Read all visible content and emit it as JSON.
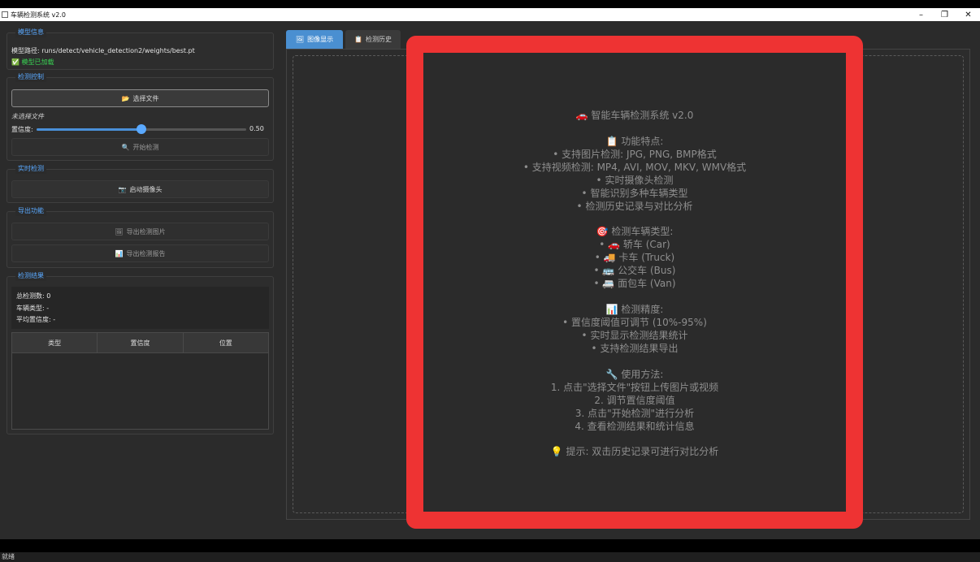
{
  "window": {
    "title": "车辆检测系统 v2.0",
    "controls": {
      "minimize": "–",
      "restore": "❐",
      "close": "✕"
    }
  },
  "model_info": {
    "title": "模型信息",
    "path_label": "模型路径: runs/detect/vehicle_detection2/weights/best.pt",
    "loaded_status": "✅ 模型已加载",
    "status_color": "#39d353"
  },
  "detect_control": {
    "title": "检测控制",
    "select_file_button": "选择文件",
    "select_file_icon": "📂",
    "no_file_label": "未选择文件",
    "confidence_label": "置信度:",
    "confidence_value": "0.50",
    "confidence_fraction": 0.5,
    "start_button": "开始检测",
    "start_icon": "🔍"
  },
  "realtime": {
    "title": "实时检测",
    "camera_button": "启动摄像头",
    "camera_icon": "📷"
  },
  "export": {
    "title": "导出功能",
    "export_image_button": "导出检测图片",
    "export_image_icon": "🖼",
    "export_report_button": "导出检测报告",
    "export_report_icon": "📊"
  },
  "results": {
    "title": "检测结果",
    "total": "总检测数: 0",
    "vehicle_type": "车辆类型: -",
    "avg_conf": "平均置信度: -",
    "columns": [
      "类型",
      "置信度",
      "位置"
    ]
  },
  "tabs": [
    {
      "label": "图像显示",
      "icon": "🖼",
      "active": true
    },
    {
      "label": "检测历史",
      "icon": "📋",
      "active": false
    }
  ],
  "info_lines": [
    "🚗 智能车辆检测系统 v2.0",
    "",
    "📋 功能特点:",
    "• 支持图片检测: JPG, PNG, BMP格式",
    "• 支持视频检测: MP4, AVI, MOV, MKV, WMV格式",
    "• 实时摄像头检测",
    "• 智能识别多种车辆类型",
    "• 检测历史记录与对比分析",
    "",
    "🎯 检测车辆类型:",
    "• 🚗 轿车 (Car)",
    "• 🚚 卡车 (Truck)",
    "• 🚌 公交车 (Bus)",
    "• 🚐 面包车 (Van)",
    "",
    "📊 检测精度:",
    "• 置信度阈值可调节 (10%-95%)",
    "• 实时显示检测结果统计",
    "• 支持检测结果导出",
    "",
    "🔧 使用方法:",
    "1. 点击\"选择文件\"按钮上传图片或视频",
    "2. 调节置信度阈值",
    "3. 点击\"开始检测\"进行分析",
    "4. 查看检测结果和统计信息",
    "",
    "💡 提示: 双击历史记录可进行对比分析"
  ],
  "status_bar": "就绪",
  "colors": {
    "accent": "#4a8fd1",
    "highlight": "#ee3333",
    "group_title": "#5aa9ff"
  }
}
